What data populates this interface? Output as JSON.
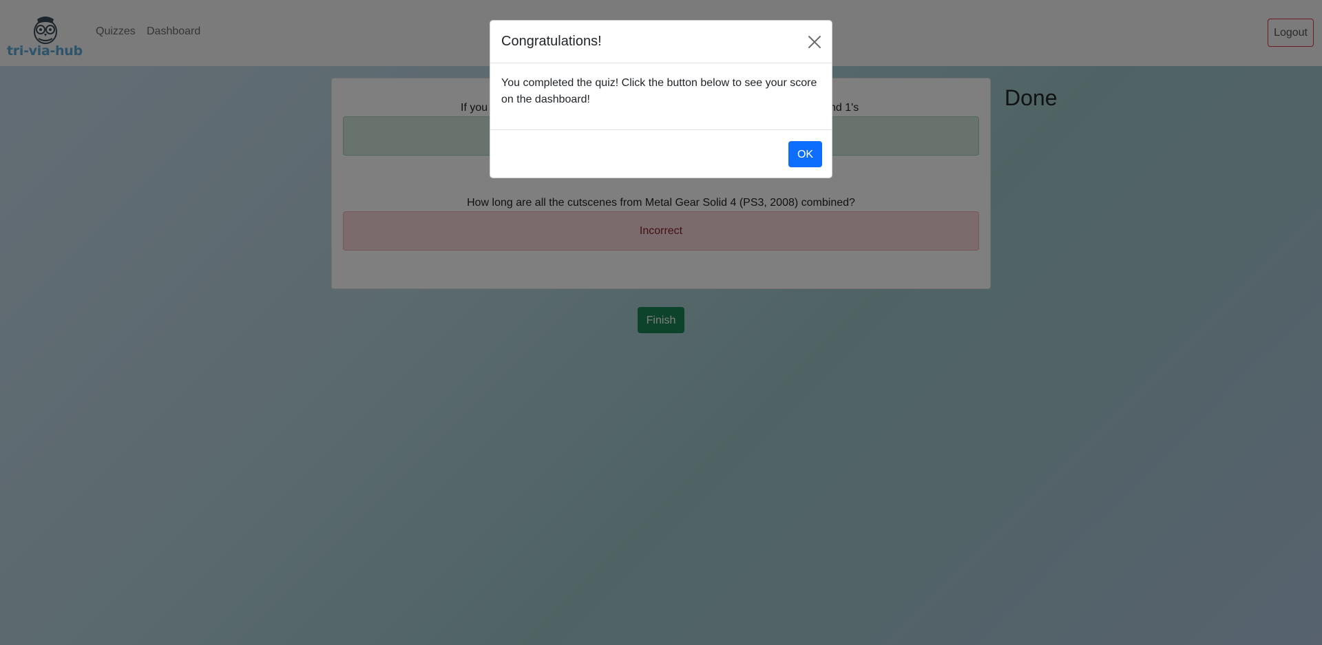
{
  "navbar": {
    "brand_name": "tri-via-hub",
    "links": [
      "Quizzes",
      "Dashboard"
    ],
    "logout_label": "Logout"
  },
  "quiz": {
    "questions": [
      {
        "text": "If you",
        "text_right": "nd 1's",
        "result": "",
        "status": "correct"
      },
      {
        "text": "How long are all the cutscenes from Metal Gear Solid 4 (PS3, 2008) combined?",
        "result": "Incorrect",
        "status": "incorrect"
      }
    ],
    "status_title": "Done",
    "finish_label": "Finish"
  },
  "modal": {
    "title": "Congratulations!",
    "body": "You completed the quiz! Click the button below to see your score on the dashboard!",
    "ok_label": "OK"
  },
  "colors": {
    "correct_bg": "#d1e7dd",
    "incorrect_bg": "#f8d7da",
    "finish": "#198754",
    "ok": "#0d6efd",
    "brand": "#5aa9d6",
    "logout_border": "#dc3545"
  }
}
